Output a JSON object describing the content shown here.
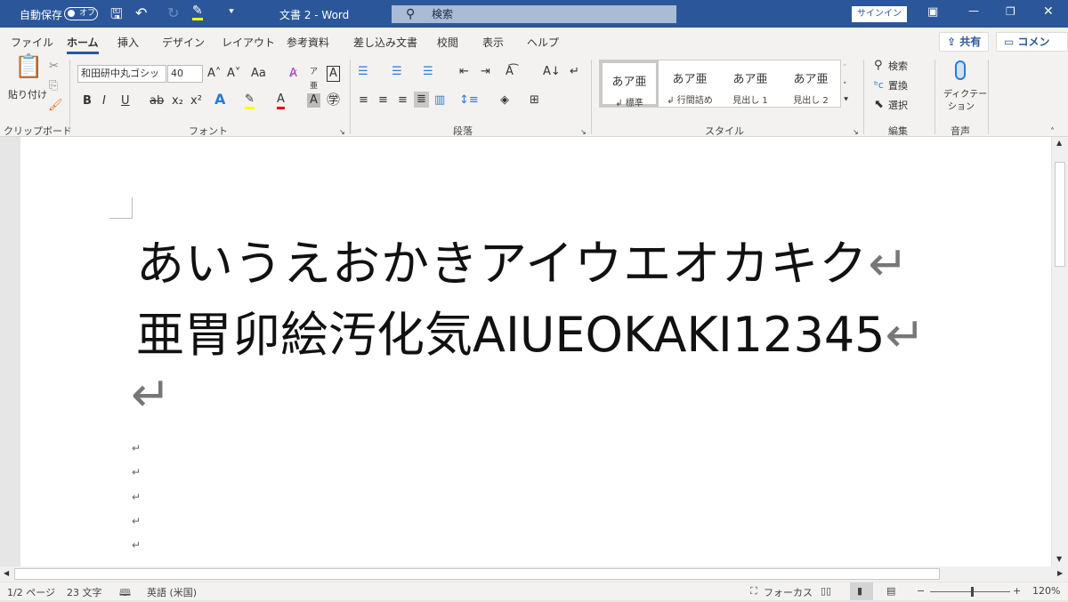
{
  "titlebar": {
    "autosave": "自動保存",
    "autosave_state": "オフ",
    "doc_title": "文書 2  -  Word",
    "search_placeholder": "検索",
    "signin": "サインイン",
    "highlight_color": "#ffff00",
    "brand_color": "#2b579a"
  },
  "tabs": [
    "ファイル",
    "ホーム",
    "挿入",
    "デザイン",
    "レイアウト",
    "参考資料",
    "差し込み文書",
    "校閲",
    "表示",
    "ヘルプ"
  ],
  "active_tab": "ホーム",
  "share": "共有",
  "comment": "コメント",
  "ribbon": {
    "clipboard": {
      "paste": "貼り付け",
      "label": "クリップボード"
    },
    "font": {
      "name": "和田研中丸ゴシッ",
      "size": "40",
      "label": "フォント",
      "case": "Aa"
    },
    "paragraph": {
      "label": "段落"
    },
    "styles": {
      "label": "スタイル",
      "items": [
        {
          "sample": "あア亜",
          "name": "↲ 標準"
        },
        {
          "sample": "あア亜",
          "name": "↲ 行間詰め"
        },
        {
          "sample": "あア亜",
          "name": "見出し 1"
        },
        {
          "sample": "あア亜",
          "name": "見出し 2"
        }
      ]
    },
    "editing": {
      "find": "検索",
      "replace": "置換",
      "select": "選択",
      "label": "編集"
    },
    "voice": {
      "dictate1": "ディクテー",
      "dictate2": "ション",
      "label": "音声"
    }
  },
  "document": {
    "line1": "あいうえおかきアイウエオカキク",
    "line2": "亜胃卯絵汚化気AIUEOKAKI12345",
    "return_mark": "↵"
  },
  "status": {
    "page": "1/2 ページ",
    "words": "23 文字",
    "language": "英語 (米国)",
    "focus": "フォーカス",
    "zoom": "120%",
    "zoom_level": 120
  }
}
